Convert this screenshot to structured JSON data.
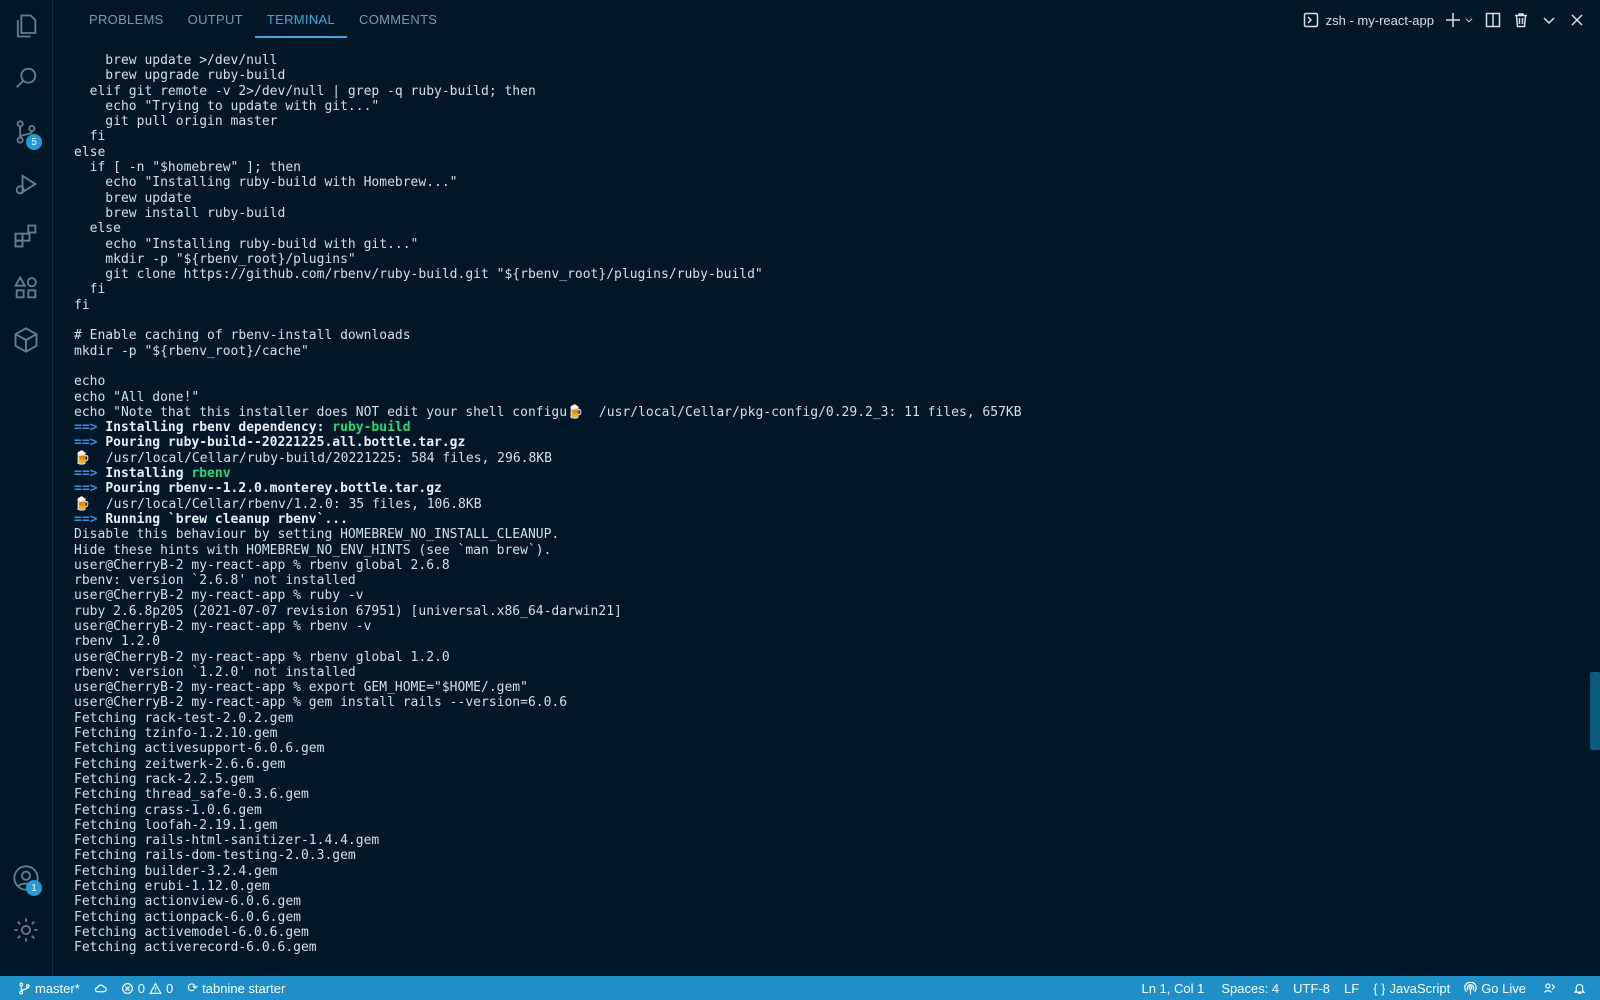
{
  "panel": {
    "tabs": [
      {
        "label": "PROBLEMS"
      },
      {
        "label": "OUTPUT"
      },
      {
        "label": "TERMINAL"
      },
      {
        "label": "COMMENTS"
      }
    ],
    "active_tab": "TERMINAL",
    "terminal_name": "zsh - my-react-app"
  },
  "activity_bar": {
    "source_control_badge": "5",
    "accounts_badge": "1"
  },
  "terminal_lines": [
    [
      {
        "t": "    brew update >/dev/null"
      }
    ],
    [
      {
        "t": "    brew upgrade ruby-build"
      }
    ],
    [
      {
        "t": "  elif git remote -v 2>/dev/null | grep -q ruby-build; then"
      }
    ],
    [
      {
        "t": "    echo \"Trying to update with git...\""
      }
    ],
    [
      {
        "t": "    git pull origin master"
      }
    ],
    [
      {
        "t": "  fi"
      }
    ],
    [
      {
        "t": "else"
      }
    ],
    [
      {
        "t": "  if [ -n \"$homebrew\" ]; then"
      }
    ],
    [
      {
        "t": "    echo \"Installing ruby-build with Homebrew...\""
      }
    ],
    [
      {
        "t": "    brew update"
      }
    ],
    [
      {
        "t": "    brew install ruby-build"
      }
    ],
    [
      {
        "t": "  else"
      }
    ],
    [
      {
        "t": "    echo \"Installing ruby-build with git...\""
      }
    ],
    [
      {
        "t": "    mkdir -p \"${rbenv_root}/plugins\""
      }
    ],
    [
      {
        "t": "    git clone https://github.com/rbenv/ruby-build.git \"${rbenv_root}/plugins/ruby-build\""
      }
    ],
    [
      {
        "t": "  fi"
      }
    ],
    [
      {
        "t": "fi"
      }
    ],
    [
      {
        "t": ""
      }
    ],
    [
      {
        "t": "# Enable caching of rbenv-install downloads"
      }
    ],
    [
      {
        "t": "mkdir -p \"${rbenv_root}/cache\""
      }
    ],
    [
      {
        "t": ""
      }
    ],
    [
      {
        "t": "echo"
      }
    ],
    [
      {
        "t": "echo \"All done!\""
      }
    ],
    [
      {
        "t": "echo \"Note that this installer does NOT edit your shell configu🍺  /usr/local/Cellar/pkg-config/0.29.2_3: 11 files, 657KB"
      }
    ],
    [
      {
        "t": "==> ",
        "c": "arrow"
      },
      {
        "t": "Installing rbenv dependency: ",
        "c": "bold"
      },
      {
        "t": "ruby-build",
        "c": "green"
      }
    ],
    [
      {
        "t": "==> ",
        "c": "arrow"
      },
      {
        "t": "Pouring ruby-build--20221225.all.bottle.tar.gz",
        "c": "bold"
      }
    ],
    [
      {
        "t": "🍺  /usr/local/Cellar/ruby-build/20221225: 584 files, 296.8KB"
      }
    ],
    [
      {
        "t": "==> ",
        "c": "arrow"
      },
      {
        "t": "Installing ",
        "c": "bold"
      },
      {
        "t": "rbenv",
        "c": "green"
      }
    ],
    [
      {
        "t": "==> ",
        "c": "arrow"
      },
      {
        "t": "Pouring rbenv--1.2.0.monterey.bottle.tar.gz",
        "c": "bold"
      }
    ],
    [
      {
        "t": "🍺  /usr/local/Cellar/rbenv/1.2.0: 35 files, 106.8KB"
      }
    ],
    [
      {
        "t": "==> ",
        "c": "arrow"
      },
      {
        "t": "Running `brew cleanup rbenv`...",
        "c": "bold"
      }
    ],
    [
      {
        "t": "Disable this behaviour by setting HOMEBREW_NO_INSTALL_CLEANUP."
      }
    ],
    [
      {
        "t": "Hide these hints with HOMEBREW_NO_ENV_HINTS (see `man brew`)."
      }
    ],
    [
      {
        "t": "user@CherryB-2 my-react-app % rbenv global 2.6.8"
      }
    ],
    [
      {
        "t": "rbenv: version `2.6.8' not installed"
      }
    ],
    [
      {
        "t": "user@CherryB-2 my-react-app % ruby -v"
      }
    ],
    [
      {
        "t": "ruby 2.6.8p205 (2021-07-07 revision 67951) [universal.x86_64-darwin21]"
      }
    ],
    [
      {
        "t": "user@CherryB-2 my-react-app % rbenv -v"
      }
    ],
    [
      {
        "t": "rbenv 1.2.0"
      }
    ],
    [
      {
        "t": "user@CherryB-2 my-react-app % rbenv global 1.2.0"
      }
    ],
    [
      {
        "t": "rbenv: version `1.2.0' not installed"
      }
    ],
    [
      {
        "t": "user@CherryB-2 my-react-app % export GEM_HOME=\"$HOME/.gem\""
      }
    ],
    [
      {
        "t": "user@CherryB-2 my-react-app % gem install rails --version=6.0.6"
      }
    ],
    [
      {
        "t": "Fetching rack-test-2.0.2.gem"
      }
    ],
    [
      {
        "t": "Fetching tzinfo-1.2.10.gem"
      }
    ],
    [
      {
        "t": "Fetching activesupport-6.0.6.gem"
      }
    ],
    [
      {
        "t": "Fetching zeitwerk-2.6.6.gem"
      }
    ],
    [
      {
        "t": "Fetching rack-2.2.5.gem"
      }
    ],
    [
      {
        "t": "Fetching thread_safe-0.3.6.gem"
      }
    ],
    [
      {
        "t": "Fetching crass-1.0.6.gem"
      }
    ],
    [
      {
        "t": "Fetching loofah-2.19.1.gem"
      }
    ],
    [
      {
        "t": "Fetching rails-html-sanitizer-1.4.4.gem"
      }
    ],
    [
      {
        "t": "Fetching rails-dom-testing-2.0.3.gem"
      }
    ],
    [
      {
        "t": "Fetching builder-3.2.4.gem"
      }
    ],
    [
      {
        "t": "Fetching erubi-1.12.0.gem"
      }
    ],
    [
      {
        "t": "Fetching actionview-6.0.6.gem"
      }
    ],
    [
      {
        "t": "Fetching actionpack-6.0.6.gem"
      }
    ],
    [
      {
        "t": "Fetching activemodel-6.0.6.gem"
      }
    ],
    [
      {
        "t": "Fetching activerecord-6.0.6.gem"
      }
    ]
  ],
  "status_bar": {
    "branch": "master*",
    "errors": "0",
    "warnings": "0",
    "tabnine": "tabnine starter",
    "position": "Ln 1, Col 1",
    "spaces": "Spaces: 4",
    "encoding": "UTF-8",
    "eol": "LF",
    "language": "JavaScript",
    "go_live": "Go Live"
  },
  "colors": {
    "background": "#011627",
    "accent": "#1f8fc9",
    "arrow": "#3a8ddc",
    "green": "#22da6e"
  }
}
